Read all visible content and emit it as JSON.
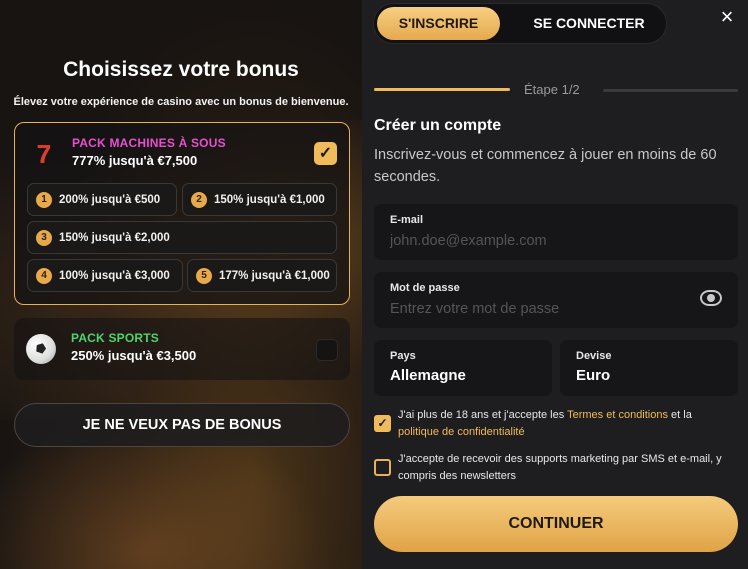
{
  "bonus": {
    "title": "Choisissez votre bonus",
    "subtitle": "Élevez votre expérience de casino avec un bonus de bienvenue.",
    "slots_pack": {
      "name": "PACK MACHINES À SOUS",
      "value": "777% jusqu'à €7,500",
      "selected": true,
      "options": [
        {
          "num": "1",
          "label": "200% jusqu'à €500"
        },
        {
          "num": "2",
          "label": "150% jusqu'à €1,000"
        },
        {
          "num": "3",
          "label": "150% jusqu'à €2,000"
        },
        {
          "num": "4",
          "label": "100% jusqu'à €3,000"
        },
        {
          "num": "5",
          "label": "177% jusqu'à €1,000"
        }
      ]
    },
    "sports_pack": {
      "name": "PACK SPORTS",
      "value": "250% jusqu'à €3,500",
      "selected": false
    },
    "no_bonus_label": "JE NE VEUX PAS DE BONUS"
  },
  "tabs": {
    "register": "S'INSCRIRE",
    "login": "SE CONNECTER"
  },
  "close_icon": "×",
  "step": "Étape 1/2",
  "form": {
    "title": "Créer un compte",
    "description": "Inscrivez-vous et commencez à jouer en moins de 60 secondes.",
    "email": {
      "label": "E-mail",
      "placeholder": "john.doe@example.com"
    },
    "password": {
      "label": "Mot de passe",
      "placeholder": "Entrez votre mot de passe"
    },
    "country": {
      "label": "Pays",
      "value": "Allemagne"
    },
    "currency": {
      "label": "Devise",
      "value": "Euro"
    },
    "terms": {
      "text1": "J'ai plus de 18 ans et j'accepte les ",
      "link1": "Termes et conditions",
      "text2": " et la ",
      "link2": "politique de confidentialité",
      "checked": true
    },
    "marketing": {
      "text": "J'accepte de recevoir des supports marketing par SMS et e-mail, y compris des newsletters",
      "checked": false
    },
    "continue_label": "CONTINUER"
  },
  "colors": {
    "accent": "#f0bb5a",
    "pink": "#e84fd0",
    "green": "#4fd36b"
  }
}
